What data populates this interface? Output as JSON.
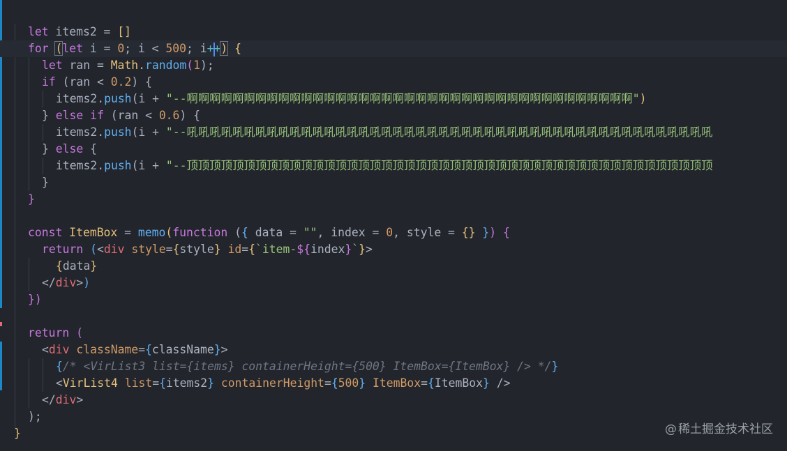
{
  "editor": {
    "lines": {
      "l1": [
        "let",
        " items2 = ",
        "[]"
      ],
      "l2": [
        "for",
        " ",
        "(",
        "let",
        " i = ",
        "0",
        "; i < ",
        "500",
        "; i",
        "+",
        "+",
        ")",
        " {"
      ],
      "l3": [
        "let",
        " ran = ",
        "Math",
        ".",
        "random",
        "(",
        "1",
        ");"
      ],
      "l4": [
        "if",
        " (ran < ",
        "0.2",
        ") {"
      ],
      "l5": [
        "items2.",
        "push",
        "(i + ",
        "\"--啊啊啊啊啊啊啊啊啊啊啊啊啊啊啊啊啊啊啊啊啊啊啊啊啊啊啊啊啊啊啊啊啊啊啊啊啊啊啊\"",
        ")"
      ],
      "l6": [
        "} ",
        "else",
        " ",
        "if",
        " (ran < ",
        "0.6",
        ") {"
      ],
      "l7": [
        "items2.",
        "push",
        "(i + ",
        "\"--吼吼吼吼吼吼吼吼吼吼吼吼吼吼吼吼吼吼吼吼吼吼吼吼吼吼吼吼吼吼吼吼吼吼吼吼吼吼吼吼吼吼吼吼吼吼"
      ],
      "l8": [
        "} ",
        "else",
        " {"
      ],
      "l9": [
        "items2.",
        "push",
        "(i + ",
        "\"--顶顶顶顶顶顶顶顶顶顶顶顶顶顶顶顶顶顶顶顶顶顶顶顶顶顶顶顶顶顶顶顶顶顶顶顶顶顶顶顶顶顶顶顶顶顶"
      ],
      "l10": [
        "}"
      ],
      "l11": [
        "}"
      ],
      "l13": [
        "const",
        " ",
        "ItemBox",
        " = ",
        "memo",
        "(",
        "function",
        " (",
        "{",
        " data = ",
        "\"\"",
        ", index = ",
        "0",
        ", style = ",
        "{}",
        " ",
        "}",
        ") {"
      ],
      "l14": [
        "return",
        " (",
        "<",
        "div",
        " ",
        "style",
        "=",
        "{",
        "style",
        "}",
        " ",
        "id",
        "=",
        "{",
        "`item-",
        "${",
        "index",
        "}",
        "`",
        "}",
        ">"
      ],
      "l15": [
        "{",
        "data",
        "}"
      ],
      "l16": [
        "</",
        "div",
        ">",
        ")"
      ],
      "l17": [
        "})"
      ],
      "l19": [
        "return",
        " ("
      ],
      "l20": [
        "<",
        "div",
        " ",
        "className",
        "=",
        "{",
        "className",
        "}",
        ">"
      ],
      "l21": [
        "{",
        "/* <VirList3 list={items} containerHeight={500} ItemBox={ItemBox} /> */",
        "}"
      ],
      "l22": [
        "<",
        "VirList4",
        " ",
        "list",
        "=",
        "{",
        "items2",
        "}",
        " ",
        "containerHeight",
        "=",
        "{",
        "500",
        "}",
        " ",
        "ItemBox",
        "=",
        "{",
        "ItemBox",
        "}",
        " />"
      ],
      "l23": [
        "</",
        "div",
        ">"
      ],
      "l24": [
        ");"
      ],
      "l25": [
        "}"
      ]
    }
  },
  "watermark": {
    "icon": "@",
    "text": "稀土掘金技术社区"
  },
  "colors": {
    "background": "#22252c",
    "keyword": "#c678dd",
    "function": "#61afef",
    "number": "#d19a66",
    "string": "#98c379",
    "class": "#e5c07b",
    "tag": "#e06c75"
  }
}
